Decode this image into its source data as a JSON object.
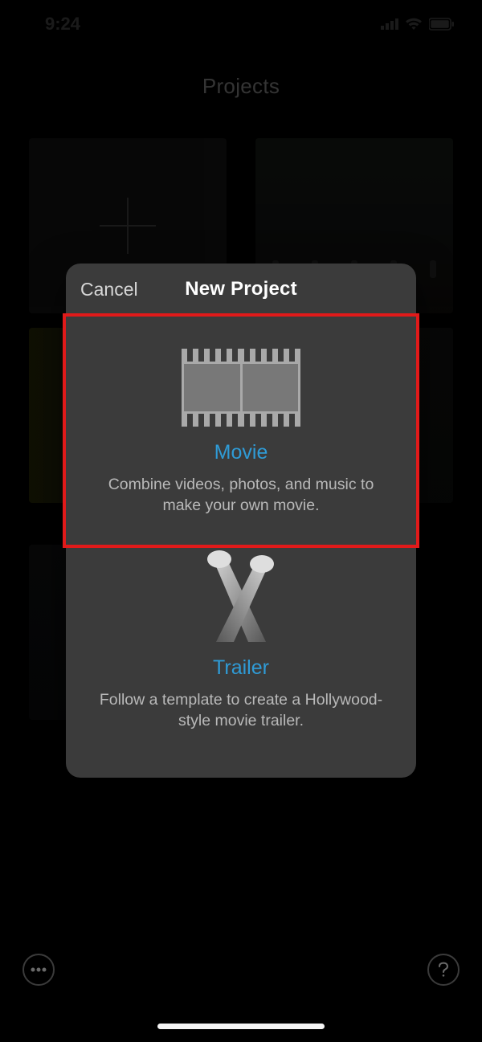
{
  "status": {
    "time": "9:24"
  },
  "page": {
    "title": "Projects"
  },
  "sheet": {
    "cancel": "Cancel",
    "title": "New Project",
    "movie": {
      "label": "Movie",
      "desc": "Combine videos, photos, and music to make your own movie."
    },
    "trailer": {
      "label": "Trailer",
      "desc": "Follow a template to create a Hollywood-style movie trailer."
    }
  }
}
